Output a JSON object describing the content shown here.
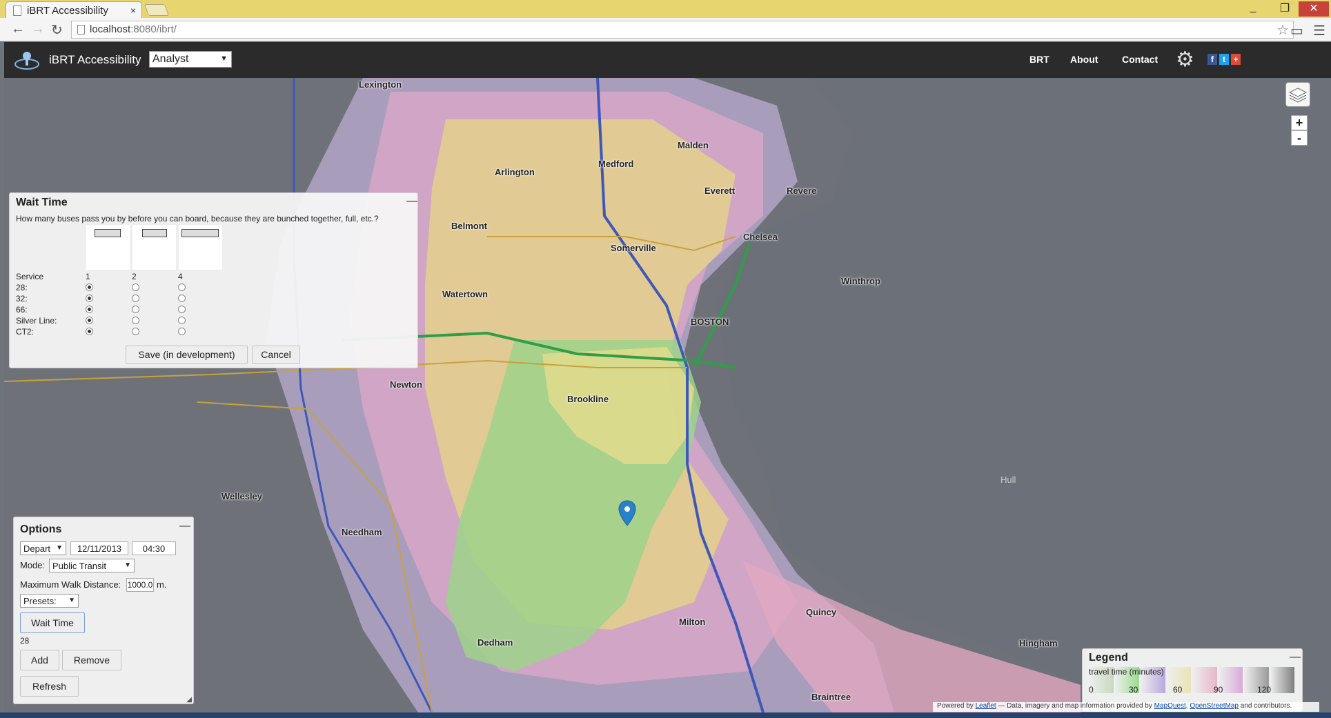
{
  "browser": {
    "tab_title": "iBRT Accessibility",
    "tab_close": "×",
    "url_host": "localhost",
    "url_rest": ":8080/ibrt/"
  },
  "app": {
    "brand": "iBRT Accessibility",
    "role": "Analyst",
    "nav": [
      "BRT",
      "About",
      "Contact"
    ],
    "social": [
      "f",
      "t",
      "+"
    ]
  },
  "map": {
    "places": [
      "Lexington",
      "Arlington",
      "Medford",
      "Malden",
      "Everett",
      "Revere",
      "Belmont",
      "Somerville",
      "Chelsea",
      "Winthrop",
      "Watertown",
      "BOSTON",
      "Newton",
      "Brookline",
      "Wellesley",
      "Needham",
      "Dedham",
      "Milton",
      "Quincy",
      "Hingham",
      "Braintree",
      "Hull"
    ],
    "zoom_in": "+",
    "zoom_out": "-"
  },
  "wait_panel": {
    "title": "Wait Time",
    "minimize": "—",
    "question": "How many buses pass you by before you can board, because they are bunched together, full, etc.?",
    "columns": [
      "1",
      "2",
      "4"
    ],
    "service_header": "Service",
    "services": [
      {
        "name": "28:",
        "selected": 0
      },
      {
        "name": "32:",
        "selected": 0
      },
      {
        "name": "66:",
        "selected": 0
      },
      {
        "name": "Silver Line:",
        "selected": 0
      },
      {
        "name": "CT2:",
        "selected": 0
      }
    ],
    "save_label": "Save (in development)",
    "cancel_label": "Cancel"
  },
  "options_panel": {
    "title": "Options",
    "minimize": "—",
    "depart": "Depart",
    "date": "12/11/2013",
    "time": "04:30",
    "mode_label": "Mode:",
    "mode_value": "Public Transit",
    "walk_label": "Maximum Walk Distance:",
    "walk_value": "1000.0",
    "walk_unit": "m.",
    "presets": "Presets:",
    "wait_button": "Wait Time",
    "route_value": "28",
    "add_label": "Add",
    "remove_label": "Remove",
    "refresh_label": "Refresh"
  },
  "legend": {
    "title": "Legend",
    "minimize": "—",
    "subtitle": "travel time (minutes)",
    "ticks": [
      "0",
      "30",
      "60",
      "90",
      "120"
    ],
    "colors": [
      "#c9d9c0",
      "#9cd98f",
      "#b9a8dd",
      "#e9e3b4",
      "#e7b7c9",
      "#d9a9d9",
      "#9a9a9a",
      "#7f7f7f"
    ]
  },
  "attribution": {
    "powered": "Powered by",
    "leaflet": "Leaflet",
    "middle": "— Data, imagery and map information provided by",
    "mapquest": "MapQuest",
    "osm": "OpenStreetMap",
    "end": "and contributors."
  }
}
